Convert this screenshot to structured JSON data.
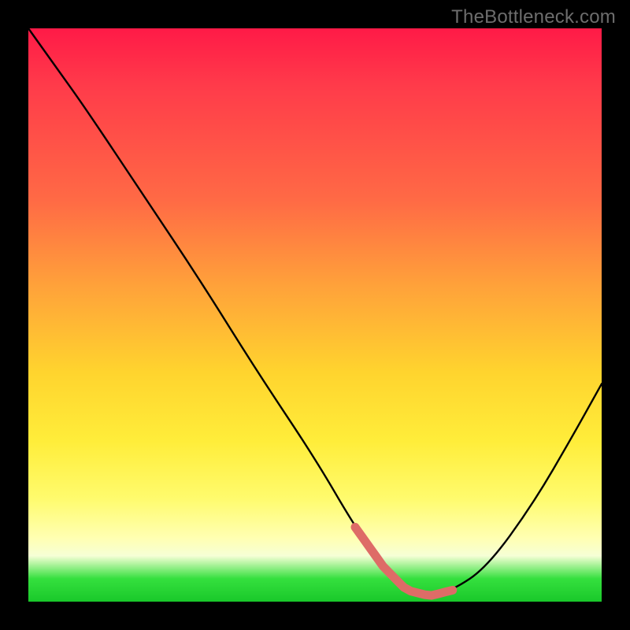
{
  "watermark": "TheBottleneck.com",
  "chart_data": {
    "type": "line",
    "title": "",
    "xlabel": "",
    "ylabel": "",
    "series": [
      {
        "name": "curve",
        "x": [
          0.0,
          0.05,
          0.1,
          0.2,
          0.3,
          0.4,
          0.5,
          0.57,
          0.62,
          0.66,
          0.7,
          0.74,
          0.8,
          0.88,
          0.95,
          1.0
        ],
        "y": [
          1.0,
          0.93,
          0.86,
          0.71,
          0.56,
          0.4,
          0.25,
          0.13,
          0.06,
          0.02,
          0.01,
          0.02,
          0.06,
          0.17,
          0.29,
          0.38
        ]
      }
    ],
    "marked_region": {
      "x_start": 0.57,
      "x_end": 0.74,
      "comment": "optimal / highlighted segment near the trough"
    },
    "xlim": [
      0,
      1
    ],
    "ylim": [
      0,
      1
    ],
    "grid": false,
    "legend": false,
    "background_gradient": [
      "#ff1a47",
      "#ffd42e",
      "#fffb6d",
      "#19c82a"
    ]
  }
}
